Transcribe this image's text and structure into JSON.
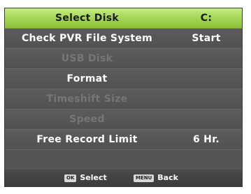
{
  "menu": {
    "rows": [
      {
        "label": "Select Disk",
        "value": "C:",
        "selected": true,
        "enabled": true
      },
      {
        "label": "Check PVR File System",
        "value": "Start",
        "selected": false,
        "enabled": true
      },
      {
        "label": "USB Disk",
        "value": "",
        "selected": false,
        "enabled": false
      },
      {
        "label": "Format",
        "value": "",
        "selected": false,
        "enabled": true
      },
      {
        "label": "Timeshift Size",
        "value": "",
        "selected": false,
        "enabled": false
      },
      {
        "label": "Speed",
        "value": "",
        "selected": false,
        "enabled": false
      },
      {
        "label": "Free Record Limit",
        "value": "6 Hr.",
        "selected": false,
        "enabled": true
      }
    ]
  },
  "footer": {
    "select_key": "OK",
    "select_label": "Select",
    "back_key": "MENU",
    "back_label": "Back"
  },
  "colors": {
    "highlight": "#a8d85a",
    "menu_background": "#555555",
    "disabled_text": "#767676"
  }
}
